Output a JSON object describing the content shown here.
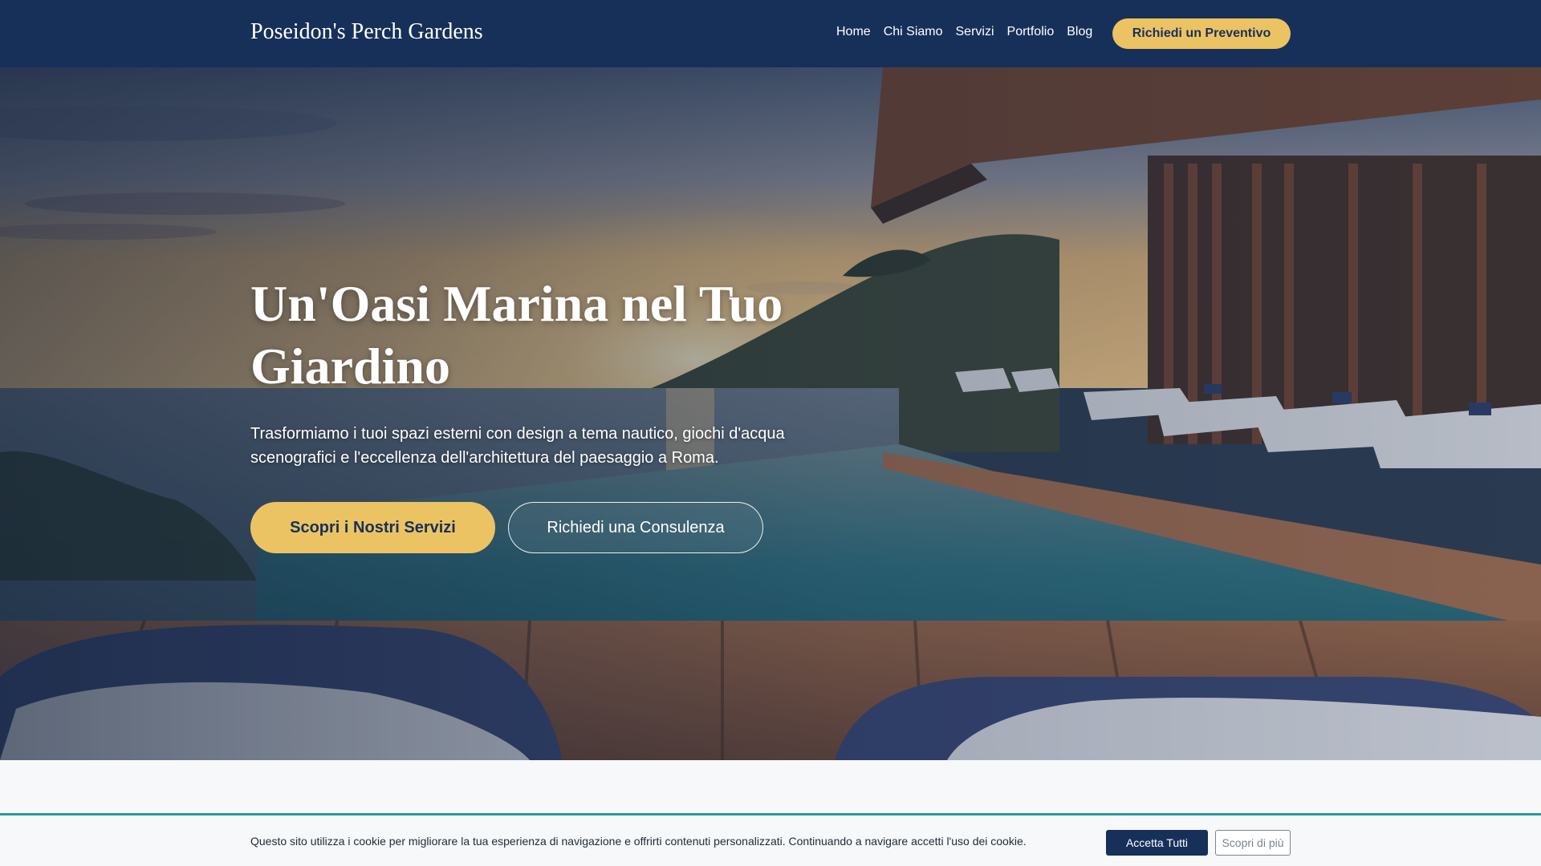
{
  "header": {
    "brand": "Poseidon's Perch Gardens",
    "nav": [
      {
        "label": "Home"
      },
      {
        "label": "Chi Siamo"
      },
      {
        "label": "Servizi"
      },
      {
        "label": "Portfolio"
      },
      {
        "label": "Blog"
      }
    ],
    "cta_label": "Richiedi un Preventivo"
  },
  "hero": {
    "title_line1": "Un'Oasi Marina nel Tuo",
    "title_line2": "Giardino",
    "subtitle_line1": "Trasformiamo i tuoi spazi esterni con design a tema nautico, giochi d'acqua",
    "subtitle_line2": "scenografici e l'eccellenza dell'architettura del paesaggio a Roma.",
    "primary_button": "Scopri i Nostri Servizi",
    "secondary_button": "Richiedi una Consulenza"
  },
  "cookie": {
    "text": "Questo sito utilizza i cookie per migliorare la tua esperienza di navigazione e offrirti contenuti personalizzati. Continuando a navigare accetti l'uso dei cookie.",
    "accept_label": "Accetta Tutti",
    "more_label": "Scopri di più"
  },
  "colors": {
    "navy": "#17305a",
    "gold": "#ecc363",
    "teal_accent": "#2a9a94"
  }
}
